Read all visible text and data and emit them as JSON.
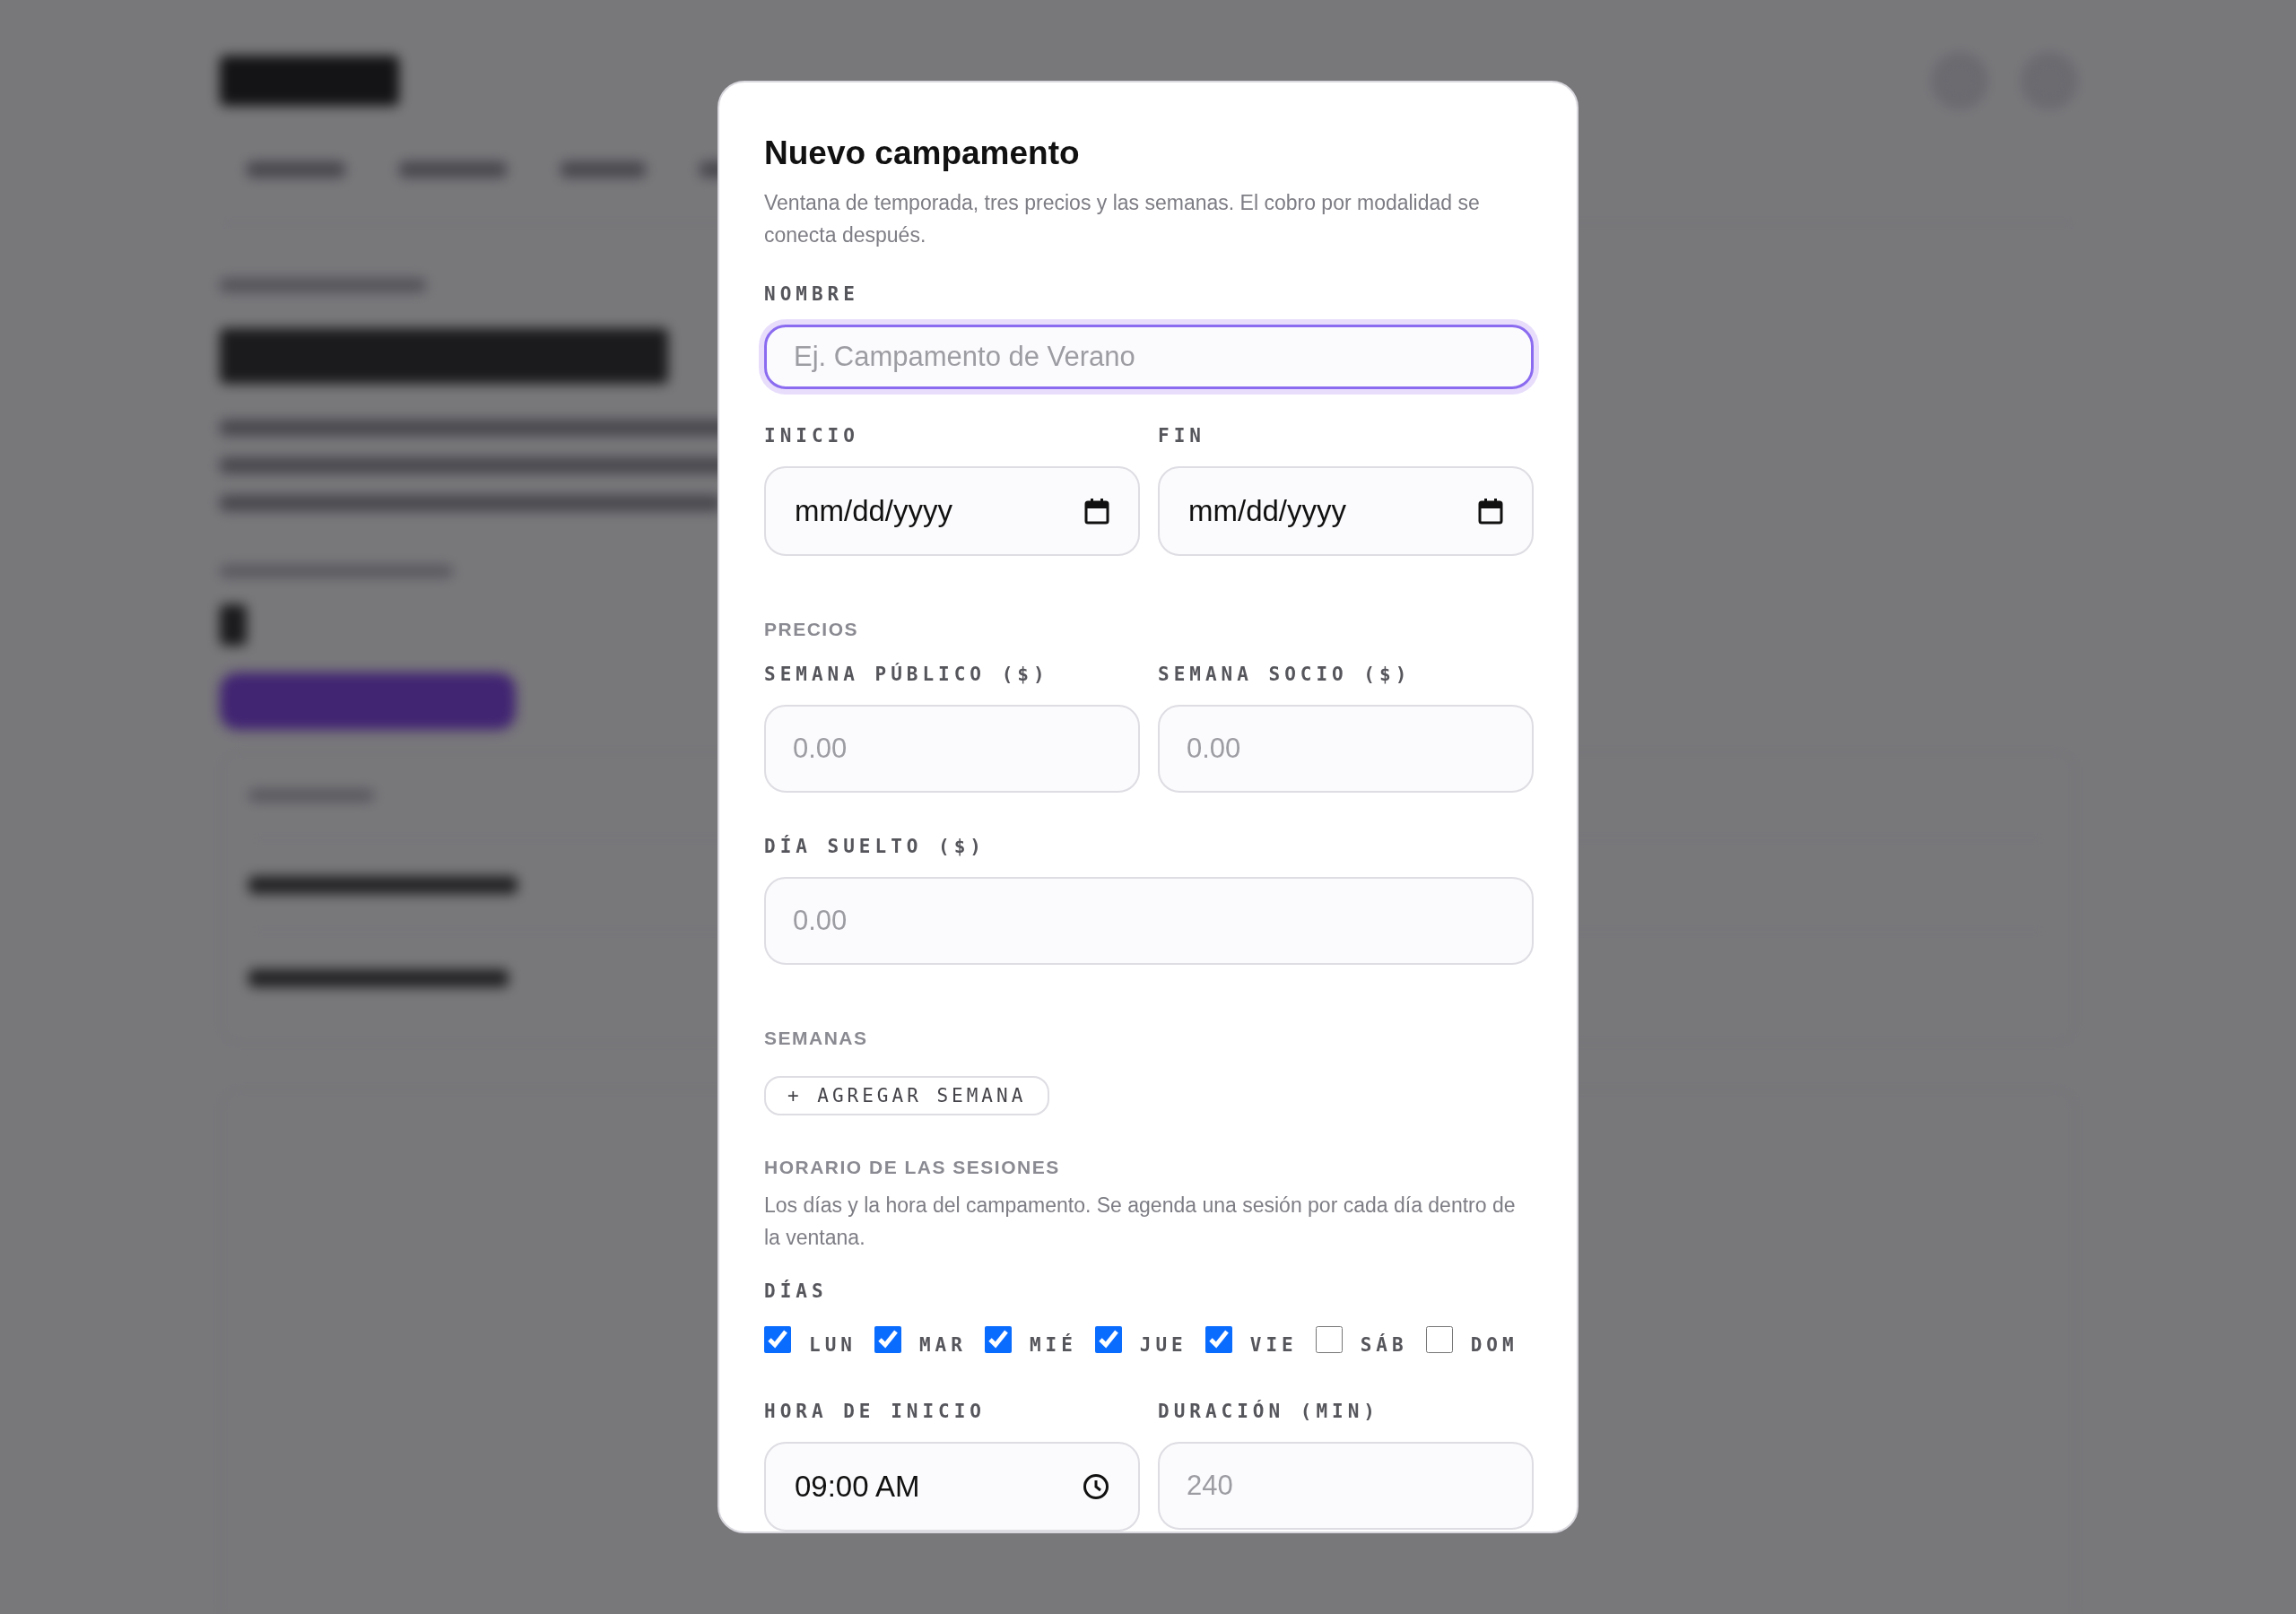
{
  "dialog": {
    "title": "Nuevo campamento",
    "description": "Ventana de temporada, tres precios y las semanas. El cobro por modalidad se conecta después.",
    "name_field": {
      "label": "NOMBRE",
      "placeholder": "Ej. Campamento de Verano",
      "focused": true
    },
    "dates": [
      {
        "label": "INICIO",
        "value": "mm/dd/yyyy"
      },
      {
        "label": "FIN",
        "value": "mm/dd/yyyy"
      }
    ],
    "prices": {
      "heading": "PRECIOS",
      "fields": [
        {
          "label": "SEMANA PÚBLICO ($)",
          "placeholder": "0.00"
        },
        {
          "label": "SEMANA SOCIO ($)",
          "placeholder": "0.00"
        },
        {
          "label": "DÍA SUELTO ($)",
          "placeholder": "0.00"
        }
      ]
    },
    "weeks": {
      "heading": "SEMANAS",
      "button": "+ AGREGAR SEMANA"
    },
    "schedule": {
      "heading": "HORARIO DE LAS SESIONES",
      "description": "Los días y la hora del campamento. Se agenda una sesión por cada día dentro de la ventana.",
      "days_label": "DÍAS",
      "days": [
        {
          "label": "LUN",
          "checked": true
        },
        {
          "label": "MAR",
          "checked": true
        },
        {
          "label": "MIÉ",
          "checked": true
        },
        {
          "label": "JUE",
          "checked": true
        },
        {
          "label": "VIE",
          "checked": true
        },
        {
          "label": "SÁB",
          "checked": false
        },
        {
          "label": "DOM",
          "checked": false
        }
      ],
      "start": {
        "label": "HORA DE INICIO",
        "value": "09:00 AM"
      },
      "duration": {
        "label": "DURACIÓN (MIN)",
        "placeholder": "240"
      }
    }
  }
}
